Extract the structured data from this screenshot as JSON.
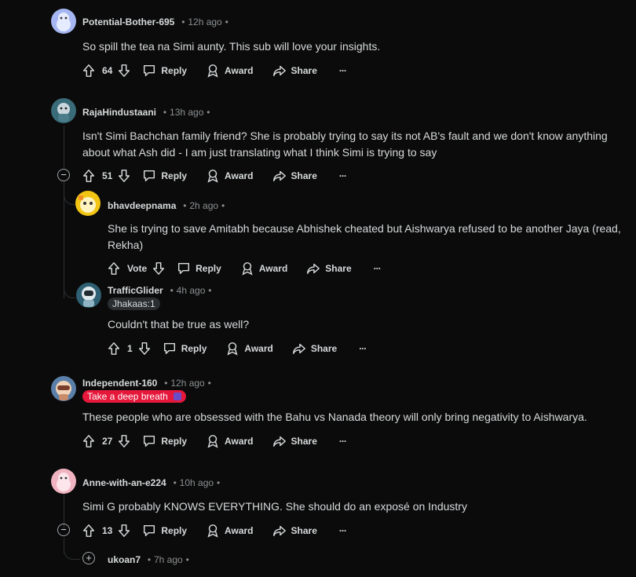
{
  "labels": {
    "reply": "Reply",
    "award": "Award",
    "share": "Share",
    "vote": "Vote",
    "more": "···",
    "dot": "•"
  },
  "comments": [
    {
      "author": "Potential-Bother-695",
      "time": "12h ago",
      "text": "So spill the tea na Simi aunty. This sub will love your insights.",
      "score": "64"
    },
    {
      "author": "RajaHindustaani",
      "time": "13h ago",
      "text": "Isn't Simi Bachchan family friend? She is probably trying to say its not AB's fault and we don't know anything about what Ash did - I am just translating what I think Simi is trying to say",
      "score": "51"
    },
    {
      "author": "bhavdeepnama",
      "time": "2h ago",
      "text": "She is trying to save Amitabh because Abhishek cheated but Aishwarya refused to be another Jaya (read, Rekha)",
      "score": "Vote"
    },
    {
      "author": "TrafficGlider",
      "time": "4h ago",
      "flair": "Jhakaas:1",
      "text": "Couldn't that be true as well?",
      "score": "1"
    },
    {
      "author": "Independent-160",
      "time": "12h ago",
      "flair": "Take a deep breath",
      "text": "These people who are obsessed with the Bahu vs Nanada theory will only bring negativity to Aishwarya.",
      "score": "27"
    },
    {
      "author": "Anne-with-an-e224",
      "time": "10h ago",
      "text": "Simi G probably KNOWS EVERYTHING. She should do an exposé on Industry",
      "score": "13"
    },
    {
      "author": "ukoan7",
      "time": "7h ago"
    }
  ],
  "colors": {
    "flair_red": "#e5173a",
    "flair_dark": "#2a2e31",
    "accent": "#d7dadc"
  }
}
